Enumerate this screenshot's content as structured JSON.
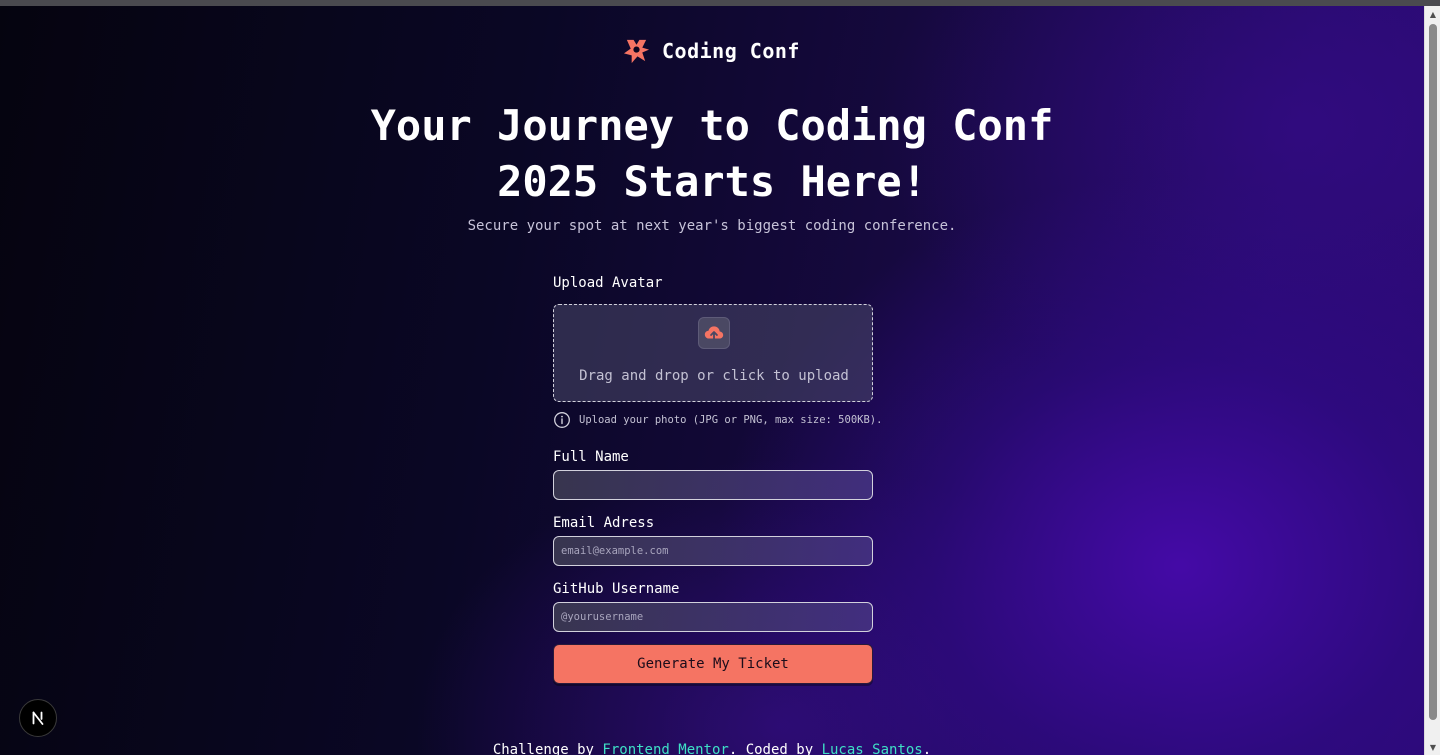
{
  "header": {
    "logo_text": "Coding Conf",
    "logo_icon": "coding-conf-logo-icon"
  },
  "hero": {
    "title_line1": "Your Journey to Coding Conf",
    "title_line2": "2025 Starts Here!",
    "subtitle": "Secure your spot at next year's biggest coding conference."
  },
  "form": {
    "avatar": {
      "label": "Upload Avatar",
      "dropzone_text": "Drag and drop or click to upload",
      "hint": "Upload your photo (JPG or PNG, max size: 500KB).",
      "icon": "upload-cloud-icon",
      "hint_icon": "info-icon"
    },
    "full_name": {
      "label": "Full Name",
      "value": "",
      "placeholder": ""
    },
    "email": {
      "label": "Email Adress",
      "value": "",
      "placeholder": "email@example.com"
    },
    "github": {
      "label": "GitHub Username",
      "value": "",
      "placeholder": "@yourusername"
    },
    "submit_label": "Generate My Ticket"
  },
  "footer": {
    "prefix": "Challenge by ",
    "link1": "Frontend Mentor",
    "middle": ". Coded by ",
    "link2": "Lucas Santos",
    "suffix": "."
  },
  "dev_badge": {
    "letter": "N",
    "icon": "nextjs-dev-indicator-icon"
  },
  "colors": {
    "accent": "#f57463",
    "link": "#3ee0c6",
    "background_dark": "#0b0620",
    "background_purple": "#2a0a72"
  }
}
